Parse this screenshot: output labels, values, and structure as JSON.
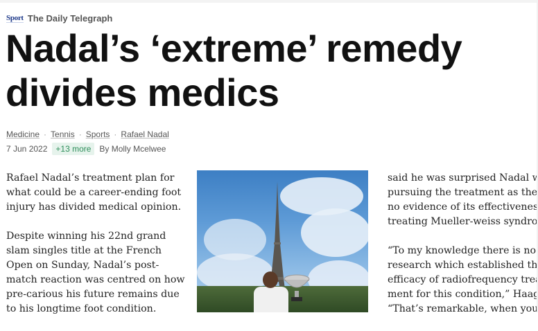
{
  "source": {
    "section_logo": "Sport",
    "publication": "The Daily Telegraph"
  },
  "article": {
    "headline": "Nadal’s ‘extreme’ remedy divides medics",
    "tags": [
      "Medicine",
      "Tennis",
      "Sports",
      "Rafael Nadal"
    ],
    "date": "7 Jun 2022",
    "more_tags": "+13 more",
    "byline": "By Molly Mcelwee",
    "col1": [
      "Rafael Nadal’s treatment plan for what could be a career-ending foot injury has divided medical opinion.",
      "Despite winning his 22nd grand slam singles title at the French Open on Sunday, Nadal’s post-match reaction was centred on how pre-carious his future remains due to his longtime foot condition."
    ],
    "col3": [
      "said he was surprised Nadal was",
      "pursuing the treatment as there",
      "no evidence of its effectiveness i",
      "treating Mueller-weiss syndrom",
      "“To my knowledge there is no",
      "research which established the",
      "efficacy of radiofrequency treat-",
      "ment for this condition,” Haag s",
      "“That’s remarkable, when you th"
    ]
  },
  "colors": {
    "headline": "#111111",
    "tag_badge_bg": "#e6f3ec",
    "tag_badge_text": "#2f8f5b",
    "sport_logo": "#1f3a8a"
  },
  "photo": {
    "description_icon": "photo-eiffel-tower-trophy"
  }
}
